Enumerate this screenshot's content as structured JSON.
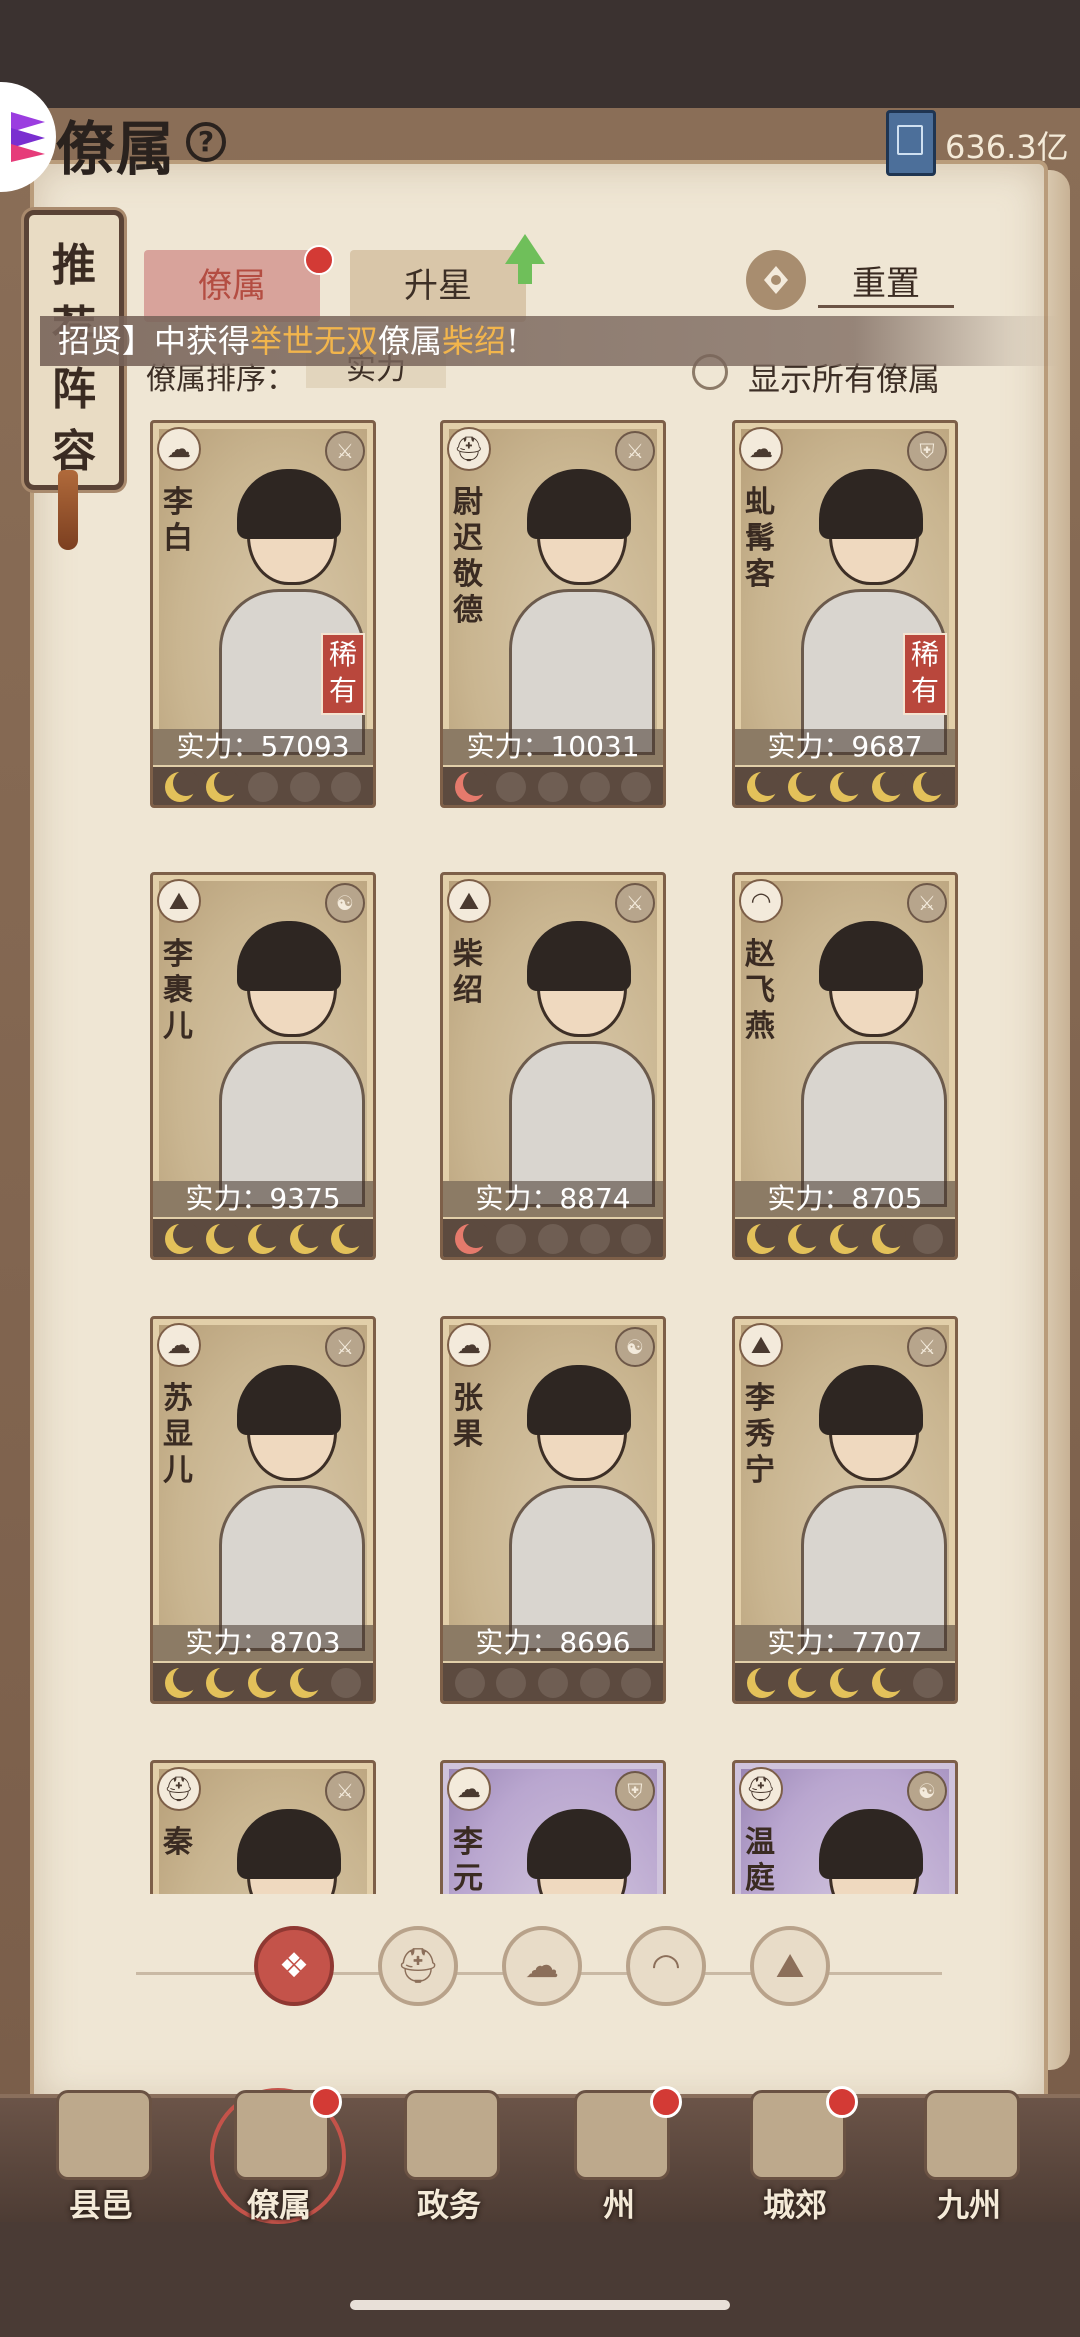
{
  "header": {
    "title": "僚属",
    "help_icon": "?",
    "currency_value": "636.3亿",
    "currency_icon": "book-icon"
  },
  "recommended": {
    "label": "推荐阵容"
  },
  "tabs": [
    {
      "label": "僚属",
      "active": true,
      "notification": true
    },
    {
      "label": "升星",
      "active": false,
      "upgrade_arrow": true
    }
  ],
  "reset": {
    "label": "重置"
  },
  "ticker": {
    "prefix": "招贤】中获得",
    "highlight": "举世无双",
    "middle": "僚属",
    "name": "柴绍",
    "suffix": "!"
  },
  "sort": {
    "label": "僚属排序：",
    "value": "实力"
  },
  "show_all": {
    "label": "显示所有僚属",
    "checked": false
  },
  "cards": [
    {
      "name": "李白",
      "power_label": "实力：57093",
      "rarity": "稀有",
      "stars_gold": 2,
      "stars_red": 0,
      "class_icon": "cloud-icon",
      "type_icon": "sword-icon",
      "purple": false
    },
    {
      "name": "尉迟敬德",
      "power_label": "实力：10031",
      "rarity": "",
      "stars_gold": 0,
      "stars_red": 1,
      "class_icon": "helmet-icon",
      "type_icon": "sword-icon",
      "purple": false
    },
    {
      "name": "虬髯客",
      "power_label": "实力：9687",
      "rarity": "稀有",
      "stars_gold": 5,
      "stars_red": 0,
      "class_icon": "cloud-icon",
      "type_icon": "shield-icon",
      "purple": false
    },
    {
      "name": "李裹儿",
      "power_label": "实力：9375",
      "rarity": "",
      "stars_gold": 5,
      "stars_red": 0,
      "class_icon": "mountain-icon",
      "type_icon": "yinyang-icon",
      "purple": false
    },
    {
      "name": "柴绍",
      "power_label": "实力：8874",
      "rarity": "",
      "stars_gold": 0,
      "stars_red": 1,
      "class_icon": "mountain-icon",
      "type_icon": "sword-icon",
      "purple": false
    },
    {
      "name": "赵飞燕",
      "power_label": "实力：8705",
      "rarity": "",
      "stars_gold": 4,
      "stars_red": 0,
      "class_icon": "fan-icon",
      "type_icon": "sword-icon",
      "purple": false
    },
    {
      "name": "苏显儿",
      "power_label": "实力：8703",
      "rarity": "",
      "stars_gold": 4,
      "stars_red": 0,
      "class_icon": "cloud-icon",
      "type_icon": "sword-icon",
      "purple": false
    },
    {
      "name": "张果",
      "power_label": "实力：8696",
      "rarity": "",
      "stars_gold": 0,
      "stars_red": 0,
      "class_icon": "cloud-icon",
      "type_icon": "yinyang-icon",
      "purple": false
    },
    {
      "name": "李秀宁",
      "power_label": "实力：7707",
      "rarity": "",
      "stars_gold": 4,
      "stars_red": 0,
      "class_icon": "mountain-icon",
      "type_icon": "sword-icon",
      "purple": false
    },
    {
      "name": "秦",
      "power_label": "",
      "rarity": "",
      "stars_gold": 0,
      "stars_red": 0,
      "class_icon": "helmet-icon",
      "type_icon": "sword-icon",
      "purple": false
    },
    {
      "name": "李元",
      "power_label": "",
      "rarity": "",
      "stars_gold": 0,
      "stars_red": 0,
      "class_icon": "cloud-icon",
      "type_icon": "shield-icon",
      "purple": true
    },
    {
      "name": "温庭",
      "power_label": "",
      "rarity": "",
      "stars_gold": 0,
      "stars_red": 0,
      "class_icon": "helmet-icon",
      "type_icon": "yinyang-icon",
      "purple": true
    }
  ],
  "filters": [
    {
      "icon": "all-icon",
      "glyph": "❖",
      "active": true
    },
    {
      "icon": "helmet-icon",
      "glyph": "⛑",
      "active": false
    },
    {
      "icon": "cloud-icon",
      "glyph": "☁",
      "active": false
    },
    {
      "icon": "fan-icon",
      "glyph": "◠",
      "active": false
    },
    {
      "icon": "mountain-icon",
      "glyph": "⛰",
      "active": false
    }
  ],
  "nav": [
    {
      "label": "县邑",
      "notification": false,
      "selected": false
    },
    {
      "label": "僚属",
      "notification": true,
      "selected": true
    },
    {
      "label": "政务",
      "notification": false,
      "selected": false
    },
    {
      "label": "州",
      "notification": true,
      "selected": false
    },
    {
      "label": "城郊",
      "notification": true,
      "selected": false
    },
    {
      "label": "九州",
      "notification": false,
      "selected": false
    }
  ],
  "colors": {
    "accent_red": "#c4534a",
    "gold_text": "#f2b54c",
    "paper": "#efe6d4"
  }
}
